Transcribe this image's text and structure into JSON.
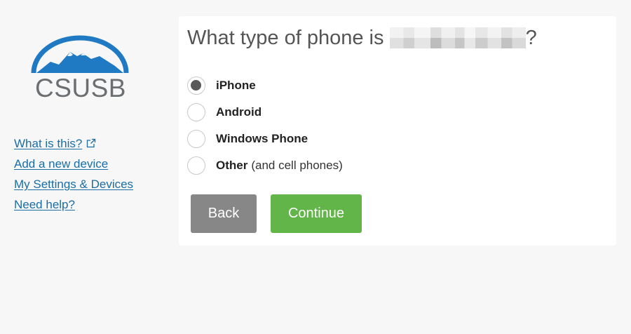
{
  "logo": {
    "text": "CSUSB",
    "colors": {
      "arc": "#1f7ac3",
      "mountain": "#1f7ac3",
      "text": "#6b6f72"
    }
  },
  "sidebar": {
    "links": [
      {
        "label": "What is this?",
        "has_external_icon": true
      },
      {
        "label": "Add a new device"
      },
      {
        "label": "My Settings & Devices"
      },
      {
        "label": "Need help?"
      }
    ]
  },
  "main": {
    "heading_prefix": "What type of phone is ",
    "heading_suffix": "?",
    "options": [
      {
        "label": "iPhone",
        "note": "",
        "checked": true
      },
      {
        "label": "Android",
        "note": "",
        "checked": false
      },
      {
        "label": "Windows Phone",
        "note": "",
        "checked": false
      },
      {
        "label": "Other",
        "note": "(and cell phones)",
        "checked": false
      }
    ],
    "buttons": {
      "back_label": "Back",
      "continue_label": "Continue"
    }
  },
  "colors": {
    "link": "#1a6ea5",
    "back_button": "#878787",
    "continue_button": "#62b548",
    "background": "#f7f7f7"
  }
}
